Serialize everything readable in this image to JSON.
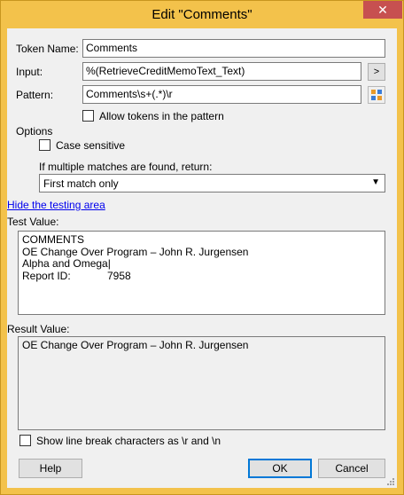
{
  "window": {
    "title": "Edit \"Comments\"",
    "close_glyph": "✕"
  },
  "form": {
    "token_name_label": "Token Name:",
    "token_name_value": "Comments",
    "input_label": "Input:",
    "input_value": "%(RetrieveCreditMemoText_Text)",
    "input_button": ">",
    "pattern_label": "Pattern:",
    "pattern_value": "Comments\\s+(.*)\\r",
    "pattern_button_icon": "grid-icon",
    "allow_tokens_label": "Allow tokens in the pattern",
    "options_label": "Options",
    "case_sensitive_label": "Case sensitive",
    "multiple_matches_label": "If multiple matches are found, return:",
    "multiple_matches_value": "First match only",
    "hide_testing_link": "Hide the testing area",
    "test_value_label": "Test Value:",
    "test_lines": [
      "COMMENTS",
      "OE Change Over Program – John R. Jurgensen",
      "Alpha and Omega",
      "Report ID:",
      "7958"
    ],
    "result_value_label": "Result Value:",
    "result_lines": [
      "OE Change Over Program – John R. Jurgensen"
    ],
    "show_line_breaks_label": "Show line break characters as \\r and \\n"
  },
  "buttons": {
    "help": "Help",
    "ok": "OK",
    "cancel": "Cancel"
  },
  "colors": {
    "titlebar": "#f3c24b",
    "close": "#c75050",
    "link": "#0000ee",
    "default_button_border": "#0078d7"
  }
}
